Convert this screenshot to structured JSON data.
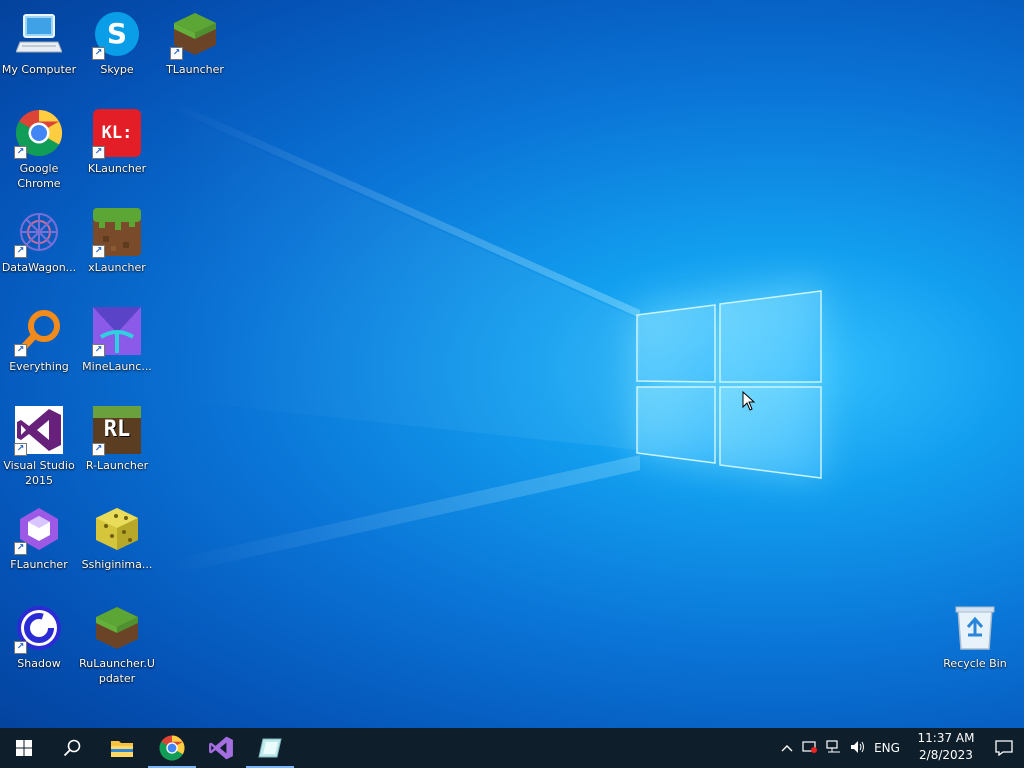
{
  "desktop": {
    "icons": [
      {
        "label": "My Computer"
      },
      {
        "label": "Skype"
      },
      {
        "label": "TLauncher"
      },
      {
        "label": "Google Chrome"
      },
      {
        "label": "KLauncher"
      },
      {
        "label": "DataWagon..."
      },
      {
        "label": "xLauncher"
      },
      {
        "label": "Everything"
      },
      {
        "label": "MineLaunc..."
      },
      {
        "label": "Visual Studio 2015"
      },
      {
        "label": "R-Launcher"
      },
      {
        "label": "FLauncher"
      },
      {
        "label": "Sshiginima..."
      },
      {
        "label": "Shadow"
      },
      {
        "label": "RuLauncher.Updater"
      },
      {
        "label": "Recycle Bin"
      }
    ],
    "icon_text": {
      "skype": "S",
      "klauncher": "KL:",
      "rlauncher": "RL"
    }
  },
  "taskbar": {
    "pinned": [
      "start-icon",
      "search-icon",
      "file-explorer-icon",
      "chrome-icon",
      "visual-studio-icon",
      "app-icon"
    ],
    "tray": {
      "language": "ENG",
      "time": "11:37 AM",
      "date": "2/8/2023"
    }
  },
  "colors": {
    "taskbar": "#0f1e2b",
    "wallpaper_blue": "#0a74d6",
    "accent": "#78b6ff"
  }
}
